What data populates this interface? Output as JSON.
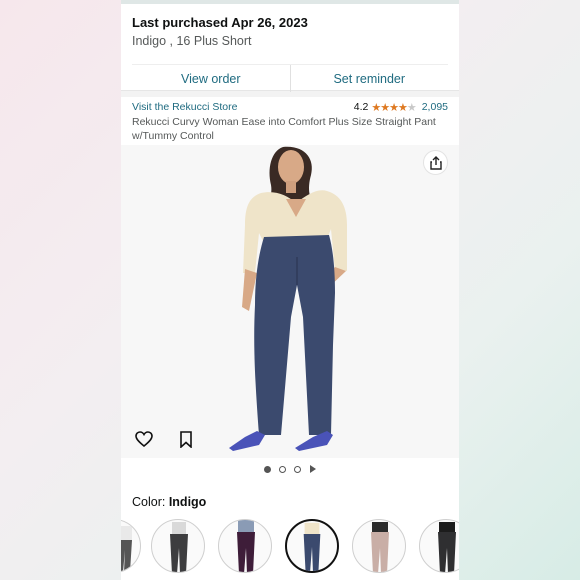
{
  "purchase": {
    "title": "Last purchased Apr 26, 2023",
    "variant": "Indigo , 16 Plus Short",
    "view_order": "View order",
    "set_reminder": "Set reminder"
  },
  "product": {
    "store_link": "Visit the Rekucci Store",
    "rating": "4.2",
    "rating_count": "2,095",
    "title": "Rekucci Curvy Woman Ease into Comfort Plus Size Straight Pant w/Tummy Control"
  },
  "image_pager": {
    "total_dots": 3,
    "active_index": 0
  },
  "color": {
    "label": "Color:",
    "selected": "Indigo",
    "swatches": [
      {
        "name": "swatch-partial",
        "pants_color": "#555555",
        "top_color": "#e9e9e9"
      },
      {
        "name": "swatch-charcoal",
        "pants_color": "#3d3d3f",
        "top_color": "#d9d9d9"
      },
      {
        "name": "swatch-plum",
        "pants_color": "#3e1d39",
        "top_color": "#8a9bb5"
      },
      {
        "name": "swatch-indigo",
        "pants_color": "#3b4a6e",
        "top_color": "#efe4c9"
      },
      {
        "name": "swatch-taupe",
        "pants_color": "#c9aea6",
        "top_color": "#2b2b2b"
      },
      {
        "name": "swatch-black",
        "pants_color": "#2f2f31",
        "top_color": "#1c1c1c"
      }
    ]
  },
  "colors": {
    "link": "#1f6b80",
    "star": "#de7921",
    "pants": "#3b4a6e",
    "shirt": "#efe4c9",
    "shoes": "#4a53b8"
  }
}
